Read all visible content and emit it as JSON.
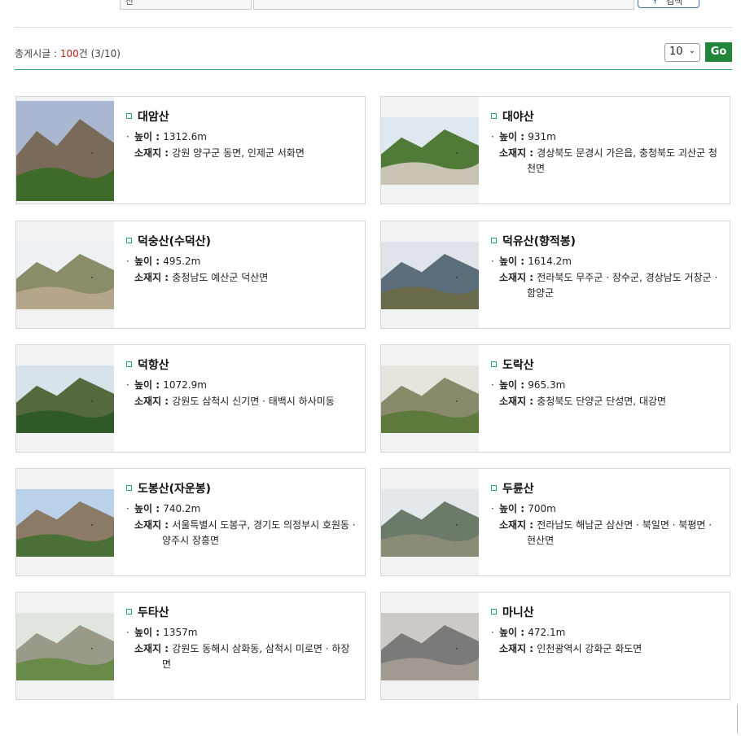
{
  "search": {
    "select_value": "산",
    "keyword_value": "",
    "button_label": "검색"
  },
  "summary": {
    "prefix": "총게시글 : ",
    "count": "100",
    "suffix": "건 (3/10)"
  },
  "pager": {
    "per_page": "10",
    "go_label": "Go"
  },
  "labels": {
    "height": "높이 : ",
    "location": "소재지 : "
  },
  "items": [
    {
      "name": "대암산",
      "height": "1312.6m",
      "location": "강원 양구군 동면, 인제군 서화면"
    },
    {
      "name": "대야산",
      "height": "931m",
      "location": "경상북도 문경시 가은읍, 충청북도 괴산군 청천면"
    },
    {
      "name": "덕숭산(수덕산)",
      "height": "495.2m",
      "location": "충청남도 예산군 덕산면"
    },
    {
      "name": "덕유산(향적봉)",
      "height": "1614.2m",
      "location": "전라북도 무주군 · 장수군, 경상남도 거창군 · 함양군"
    },
    {
      "name": "덕항산",
      "height": "1072.9m",
      "location": "강원도 삼척시 신기면 · 태백시 하사미동"
    },
    {
      "name": "도락산",
      "height": "965.3m",
      "location": "충청북도 단양군 단성면, 대강면"
    },
    {
      "name": "도봉산(자운봉)",
      "height": "740.2m",
      "location": "서울특별시 도봉구, 경기도 의정부시 호원동 · 양주시 장흥면"
    },
    {
      "name": "두륜산",
      "height": "700m",
      "location": "전라남도 해남군 삼산면 · 북일면 · 북평면 · 현산면"
    },
    {
      "name": "두타산",
      "height": "1357m",
      "location": "강원도 동해시 삼화동, 삼척시 미로면 · 하장면"
    },
    {
      "name": "마니산",
      "height": "472.1m",
      "location": "인천광역시 강화군 화도면"
    }
  ],
  "colors": {
    "accent_green": "#22863a",
    "divider_teal": "#2a9d7a",
    "count_red": "#b3261e"
  }
}
